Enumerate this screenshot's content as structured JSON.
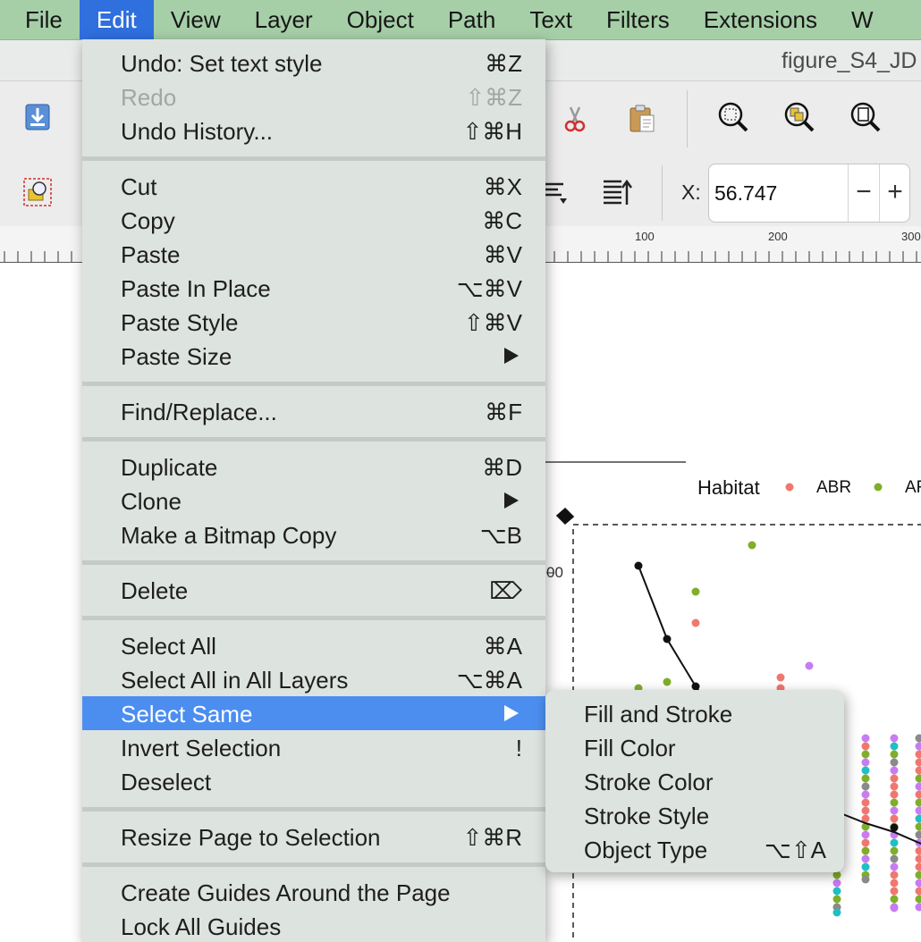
{
  "menubar": {
    "items": [
      "File",
      "Edit",
      "View",
      "Layer",
      "Object",
      "Path",
      "Text",
      "Filters",
      "Extensions",
      "W"
    ],
    "active": "Edit"
  },
  "window": {
    "title": "figure_S4_JD"
  },
  "toolbar": {
    "x_label": "X:",
    "x_value": "56.747",
    "minus": "−",
    "plus": "+"
  },
  "ruler": {
    "labels": [
      "100",
      "200",
      "300"
    ]
  },
  "canvas": {
    "legend_title": "Habitat",
    "legend_abr": "ABR",
    "legend_ar": "AF",
    "axis_tick": "00",
    "colors": {
      "salmon": "#f0776f",
      "green": "#7fae2a",
      "purple": "#c77cf2",
      "teal": "#1fbfc4",
      "gray": "#8a8a8a"
    }
  },
  "edit_menu": {
    "items": {
      "undo": {
        "label": "Undo: Set text style",
        "shortcut": "⌘Z"
      },
      "redo": {
        "label": "Redo",
        "shortcut": "⇧⌘Z",
        "disabled": true
      },
      "undo_history": {
        "label": "Undo History...",
        "shortcut": "⇧⌘H"
      },
      "cut": {
        "label": "Cut",
        "shortcut": "⌘X"
      },
      "copy": {
        "label": "Copy",
        "shortcut": "⌘C"
      },
      "paste": {
        "label": "Paste",
        "shortcut": "⌘V"
      },
      "paste_in_place": {
        "label": "Paste In Place",
        "shortcut": "⌥⌘V"
      },
      "paste_style": {
        "label": "Paste Style",
        "shortcut": "⇧⌘V"
      },
      "paste_size": {
        "label": "Paste Size",
        "submenu": true
      },
      "find_replace": {
        "label": "Find/Replace...",
        "shortcut": "⌘F"
      },
      "duplicate": {
        "label": "Duplicate",
        "shortcut": "⌘D"
      },
      "clone": {
        "label": "Clone",
        "submenu": true
      },
      "bitmap_copy": {
        "label": "Make a Bitmap Copy",
        "shortcut": "⌥B"
      },
      "delete": {
        "label": "Delete",
        "shortcut": "⌦"
      },
      "select_all": {
        "label": "Select All",
        "shortcut": "⌘A"
      },
      "select_all_layers": {
        "label": "Select All in All Layers",
        "shortcut": "⌥⌘A"
      },
      "select_same": {
        "label": "Select Same",
        "submenu": true,
        "highlighted": true
      },
      "invert_selection": {
        "label": "Invert Selection",
        "shortcut": "!"
      },
      "deselect": {
        "label": "Deselect",
        "shortcut": ""
      },
      "resize_page": {
        "label": "Resize Page to Selection",
        "shortcut": "⇧⌘R"
      },
      "create_guides": {
        "label": "Create Guides Around the Page",
        "shortcut": ""
      },
      "lock_guides": {
        "label": "Lock All Guides",
        "shortcut": ""
      }
    }
  },
  "select_same_submenu": {
    "items": {
      "fill_and_stroke": {
        "label": "Fill and Stroke",
        "shortcut": ""
      },
      "fill_color": {
        "label": "Fill Color",
        "shortcut": ""
      },
      "stroke_color": {
        "label": "Stroke Color",
        "shortcut": ""
      },
      "stroke_style": {
        "label": "Stroke Style",
        "shortcut": ""
      },
      "object_type": {
        "label": "Object Type",
        "shortcut": "⌥⇧A"
      }
    }
  }
}
